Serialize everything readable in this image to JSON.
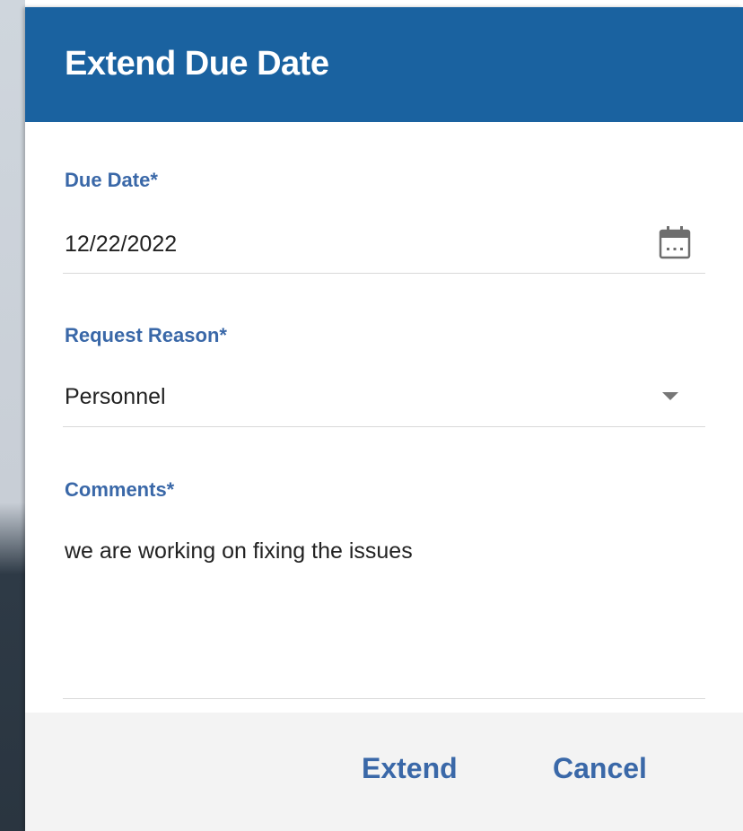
{
  "dialog": {
    "title": "Extend Due Date"
  },
  "fields": {
    "due_date": {
      "label": "Due Date*",
      "value": "12/22/2022",
      "icon": "calendar-icon"
    },
    "request_reason": {
      "label": "Request Reason*",
      "value": "Personnel",
      "icon": "chevron-down-icon"
    },
    "comments": {
      "label": "Comments*",
      "value": "we are working on fixing the issues"
    }
  },
  "actions": {
    "extend_label": "Extend",
    "cancel_label": "Cancel"
  },
  "colors": {
    "header": "#1a62a0",
    "accent": "#3a68a8",
    "footer": "#f3f3f3"
  }
}
